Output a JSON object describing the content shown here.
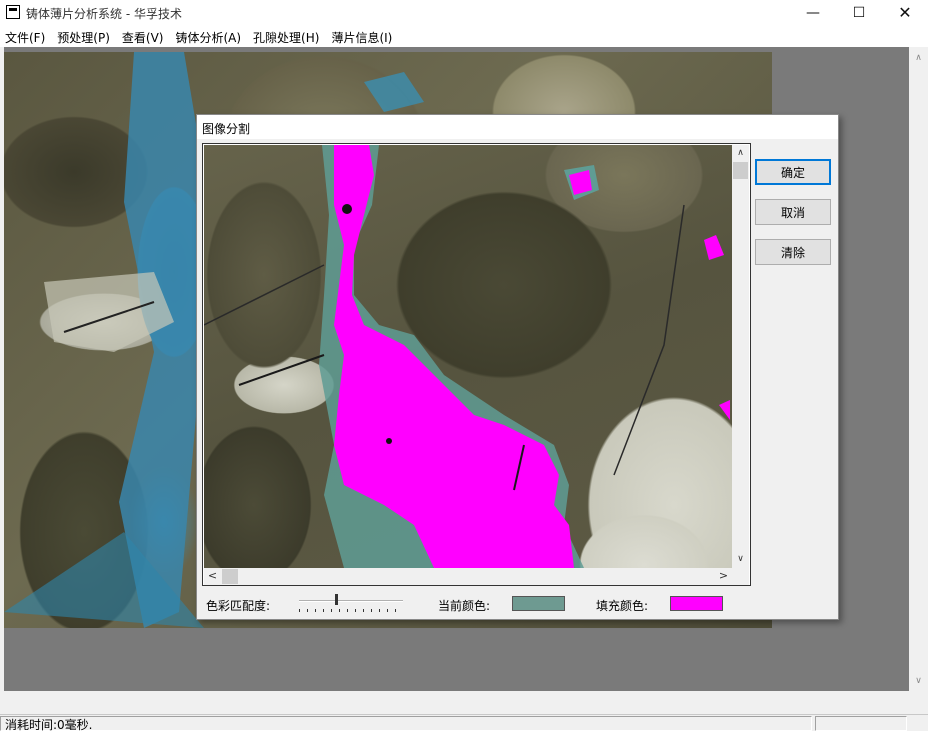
{
  "window": {
    "title": "铸体薄片分析系统 - 华孚技术",
    "minimize": "—",
    "maximize": "☐",
    "close": "✕"
  },
  "menu": {
    "items": [
      "文件(F)",
      "预处理(P)",
      "查看(V)",
      "铸体分析(A)",
      "孔隙处理(H)",
      "薄片信息(I)"
    ]
  },
  "dialog": {
    "title": "图像分割",
    "buttons": {
      "ok": "确定",
      "cancel": "取消",
      "clear": "清除"
    },
    "color_match_label": "色彩匹配度:",
    "color_match_level": 0.35,
    "current_color_label": "当前颜色:",
    "current_color": "#6e9a91",
    "fill_color_label": "填充颜色:",
    "fill_color": "#ff00ff"
  },
  "scroll": {
    "up": "▲",
    "down": "∨",
    "left": "<",
    "right": ">",
    "up_small": "∧"
  },
  "status": {
    "text": "消耗时间:0毫秒."
  },
  "icons": {
    "app": "app-icon",
    "minimize": "minimize-icon",
    "maximize": "maximize-icon",
    "close": "close-icon"
  }
}
